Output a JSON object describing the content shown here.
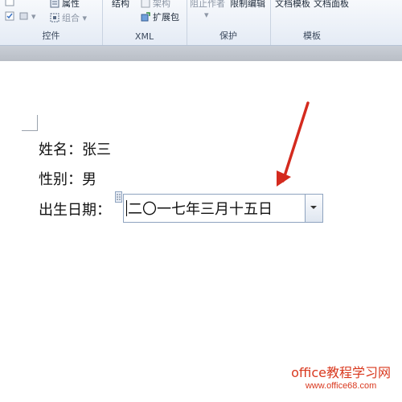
{
  "ribbon": {
    "controls_group": {
      "label": "控件",
      "properties": "属性",
      "group": "组合"
    },
    "xml_group": {
      "label": "XML",
      "structure": "结构",
      "schema": "架构",
      "expansion_pack": "扩展包"
    },
    "protect_group": {
      "label": "保护",
      "block_authors": "阻止作者",
      "restrict_editing": "限制编辑"
    },
    "templates_group": {
      "label": "模板",
      "document_template": "文档模板",
      "document_panel": "文档面板"
    }
  },
  "document": {
    "name_line": "姓名：张三",
    "gender_line": "性别：男",
    "birth_label": "出生日期：",
    "birth_value": "二〇一七年三月十五日"
  },
  "watermark": {
    "line1": "office教程学习网",
    "line2": "www.office68.com"
  },
  "colors": {
    "arrow": "#d42a1e",
    "watermark": "#d9381e",
    "control_border": "#8ea3bf"
  }
}
